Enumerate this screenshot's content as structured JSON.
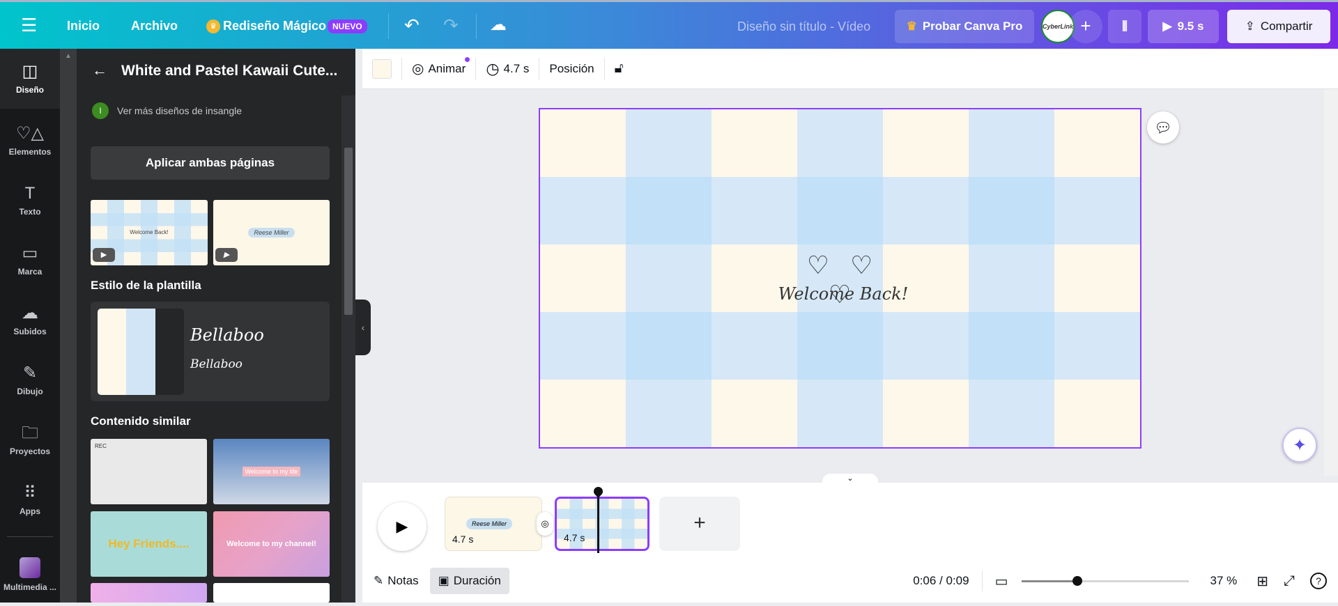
{
  "topbar": {
    "menu_icon": "hamburger-icon",
    "home": "Inicio",
    "file": "Archivo",
    "magic": "Rediseño Mágico",
    "new_badge": "NUEVO",
    "doc_title": "Diseño sin título - Vídeo",
    "try_pro": "Probar Canva Pro",
    "avatar_text": "CyberLink",
    "play_duration": "9.5 s",
    "share": "Compartir"
  },
  "rail": {
    "items": [
      {
        "label": "Diseño",
        "icon": "layout-icon"
      },
      {
        "label": "Elementos",
        "icon": "shapes-icon"
      },
      {
        "label": "Texto",
        "icon": "text-icon"
      },
      {
        "label": "Marca",
        "icon": "brand-icon"
      },
      {
        "label": "Subidos",
        "icon": "upload-icon"
      },
      {
        "label": "Dibujo",
        "icon": "draw-icon"
      },
      {
        "label": "Proyectos",
        "icon": "folder-icon"
      },
      {
        "label": "Apps",
        "icon": "apps-icon"
      },
      {
        "label": "Multimedia ...",
        "icon": "multimedia-icon"
      }
    ]
  },
  "panel": {
    "title": "White and Pastel Kawaii Cute...",
    "author_initial": "I",
    "author_link": "Ver más diseños de insangle",
    "apply_both": "Aplicar ambas páginas",
    "thumb1_text": "Welcome Back!",
    "thumb2_text": "Reese Miller",
    "style_heading": "Estilo de la plantilla",
    "style_font_1": "Bellaboo",
    "style_font_2": "Bellaboo",
    "similar_heading": "Contenido similar",
    "similar": [
      "REC",
      "Welcome to my life",
      "Hey Friends....",
      "Welcome to my channel!"
    ]
  },
  "toolbar": {
    "animate": "Animar",
    "duration": "4.7 s",
    "position": "Posición"
  },
  "canvas": {
    "title": "Welcome Back!",
    "hearts": "♡ ♡ ♡",
    "colors": {
      "cream": "#fef8ea",
      "blue": "#d6e8f7",
      "blue_dark": "#c2e0f7",
      "selection": "#8b3dff"
    }
  },
  "timeline": {
    "clips": [
      {
        "label": "4.7 s",
        "text": "Reese Miller"
      },
      {
        "label": "4.7 s"
      }
    ]
  },
  "bottom": {
    "notes": "Notas",
    "duration": "Duración",
    "time": "0:06 / 0:09",
    "zoom": "37 %",
    "zoom_fraction": 0.37
  }
}
